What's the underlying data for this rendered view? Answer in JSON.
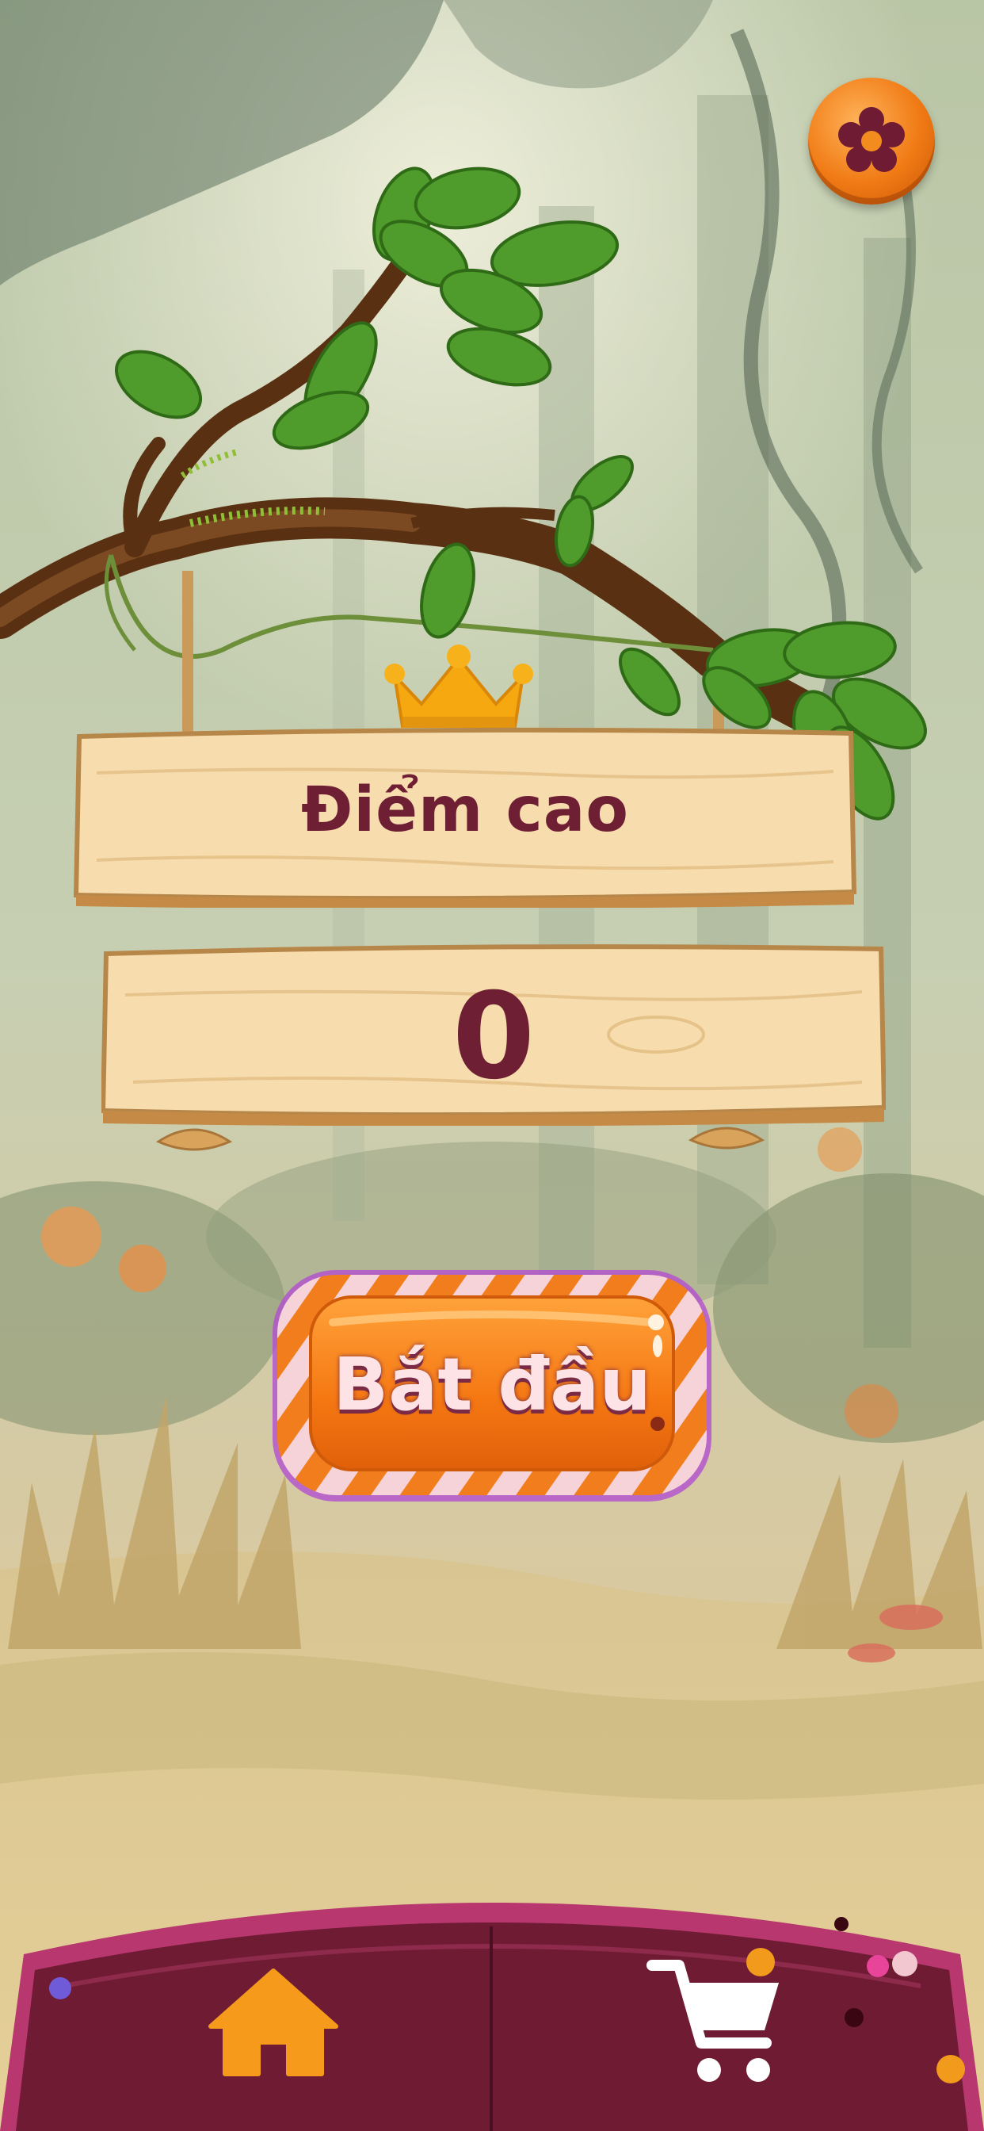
{
  "high_score": {
    "title": "Điểm cao",
    "value": "0"
  },
  "start_button": {
    "label": "Bắt đầu"
  },
  "nav": {
    "home_icon": "home-icon",
    "shop_icon": "shopping-cart-icon"
  },
  "settings_icon": "settings-gear-icon",
  "colors": {
    "text_maroon": "#6f1f34",
    "button_orange": "#f07a14",
    "nav_home": "#f59a1a",
    "bar_maroon": "#6e1b33"
  }
}
